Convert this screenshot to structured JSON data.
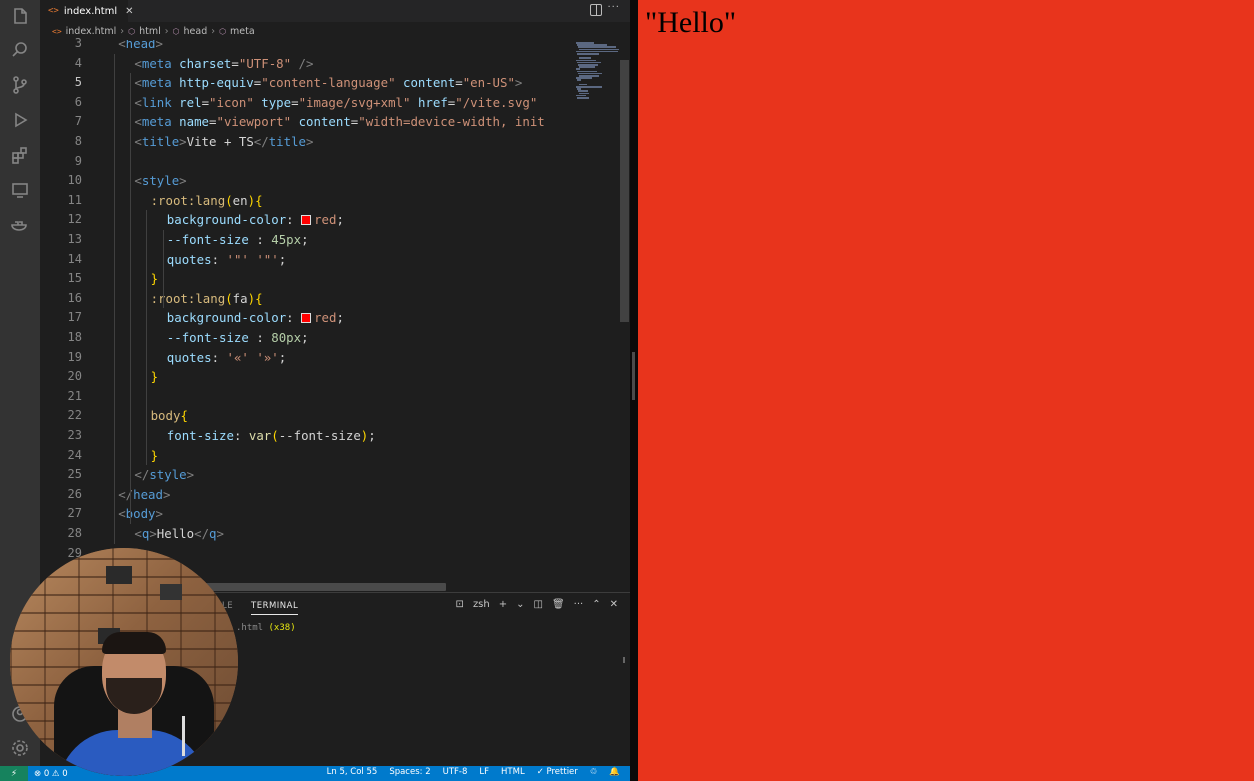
{
  "editor": {
    "tab": {
      "icon": "<>",
      "label": "index.html",
      "close": "✕"
    },
    "breadcrumb": [
      {
        "icon": "<>",
        "label": "index.html"
      },
      {
        "icon": "⬡",
        "label": "html"
      },
      {
        "icon": "⬡",
        "label": "head"
      },
      {
        "icon": "⬡",
        "label": "meta"
      }
    ],
    "active_line": 5,
    "code_lines": [
      {
        "n": 3,
        "indent": 1,
        "parts": [
          [
            "punct",
            "<"
          ],
          [
            "tag",
            "head"
          ],
          [
            "punct",
            ">"
          ]
        ]
      },
      {
        "n": 4,
        "indent": 2,
        "parts": [
          [
            "punct",
            "<"
          ],
          [
            "tag",
            "meta"
          ],
          [
            "plain",
            " "
          ],
          [
            "attr",
            "charset"
          ],
          [
            "plain",
            "="
          ],
          [
            "str",
            "\"UTF-8\""
          ],
          [
            "plain",
            " "
          ],
          [
            "punct",
            "/>"
          ]
        ]
      },
      {
        "n": 5,
        "indent": 2,
        "parts": [
          [
            "punct",
            "<"
          ],
          [
            "tag",
            "meta"
          ],
          [
            "plain",
            " "
          ],
          [
            "attr",
            "http-equiv"
          ],
          [
            "plain",
            "="
          ],
          [
            "str",
            "\"content-language\""
          ],
          [
            "plain",
            " "
          ],
          [
            "attr",
            "content"
          ],
          [
            "plain",
            "="
          ],
          [
            "str",
            "\"en-US\""
          ],
          [
            "punct",
            ">"
          ]
        ]
      },
      {
        "n": 6,
        "indent": 2,
        "parts": [
          [
            "punct",
            "<"
          ],
          [
            "tag",
            "link"
          ],
          [
            "plain",
            " "
          ],
          [
            "attr",
            "rel"
          ],
          [
            "plain",
            "="
          ],
          [
            "str",
            "\"icon\""
          ],
          [
            "plain",
            " "
          ],
          [
            "attr",
            "type"
          ],
          [
            "plain",
            "="
          ],
          [
            "str",
            "\"image/svg+xml\""
          ],
          [
            "plain",
            " "
          ],
          [
            "attr",
            "href"
          ],
          [
            "plain",
            "="
          ],
          [
            "str",
            "\"/vite.svg\""
          ]
        ]
      },
      {
        "n": 7,
        "indent": 2,
        "parts": [
          [
            "punct",
            "<"
          ],
          [
            "tag",
            "meta"
          ],
          [
            "plain",
            " "
          ],
          [
            "attr",
            "name"
          ],
          [
            "plain",
            "="
          ],
          [
            "str",
            "\"viewport\""
          ],
          [
            "plain",
            " "
          ],
          [
            "attr",
            "content"
          ],
          [
            "plain",
            "="
          ],
          [
            "str",
            "\"width=device-width, init"
          ]
        ]
      },
      {
        "n": 8,
        "indent": 2,
        "parts": [
          [
            "punct",
            "<"
          ],
          [
            "tag",
            "title"
          ],
          [
            "punct",
            ">"
          ],
          [
            "plain",
            "Vite + TS"
          ],
          [
            "punct",
            "</"
          ],
          [
            "tag",
            "title"
          ],
          [
            "punct",
            ">"
          ]
        ]
      },
      {
        "n": 9,
        "indent": 0,
        "parts": []
      },
      {
        "n": 10,
        "indent": 2,
        "parts": [
          [
            "punct",
            "<"
          ],
          [
            "tag",
            "style"
          ],
          [
            "punct",
            ">"
          ]
        ]
      },
      {
        "n": 11,
        "indent": 3,
        "parts": [
          [
            "sel",
            ":root:lang"
          ],
          [
            "brace",
            "("
          ],
          [
            "plain",
            "en"
          ],
          [
            "brace",
            ")"
          ],
          [
            "brace",
            "{"
          ]
        ]
      },
      {
        "n": 12,
        "indent": 4,
        "parts": [
          [
            "prop",
            "background-color"
          ],
          [
            "plain",
            ": "
          ],
          [
            "swatch",
            ""
          ],
          [
            "str",
            "red"
          ],
          [
            "plain",
            ";"
          ]
        ]
      },
      {
        "n": 13,
        "indent": 4,
        "parts": [
          [
            "prop",
            "--font-size"
          ],
          [
            "plain",
            " : "
          ],
          [
            "num",
            "45px"
          ],
          [
            "plain",
            ";"
          ]
        ]
      },
      {
        "n": 14,
        "indent": 4,
        "parts": [
          [
            "prop",
            "quotes"
          ],
          [
            "plain",
            ": "
          ],
          [
            "str",
            "'\"' '\"'"
          ],
          [
            "plain",
            ";"
          ]
        ]
      },
      {
        "n": 15,
        "indent": 3,
        "parts": [
          [
            "brace",
            "}"
          ]
        ]
      },
      {
        "n": 16,
        "indent": 3,
        "parts": [
          [
            "sel",
            ":root:lang"
          ],
          [
            "brace",
            "("
          ],
          [
            "plain",
            "fa"
          ],
          [
            "brace",
            ")"
          ],
          [
            "brace",
            "{"
          ]
        ]
      },
      {
        "n": 17,
        "indent": 4,
        "parts": [
          [
            "prop",
            "background-color"
          ],
          [
            "plain",
            ": "
          ],
          [
            "swatch",
            ""
          ],
          [
            "str",
            "red"
          ],
          [
            "plain",
            ";"
          ]
        ]
      },
      {
        "n": 18,
        "indent": 4,
        "parts": [
          [
            "prop",
            "--font-size"
          ],
          [
            "plain",
            " : "
          ],
          [
            "num",
            "80px"
          ],
          [
            "plain",
            ";"
          ]
        ]
      },
      {
        "n": 19,
        "indent": 4,
        "parts": [
          [
            "prop",
            "quotes"
          ],
          [
            "plain",
            ": "
          ],
          [
            "str",
            "'«' '»'"
          ],
          [
            "plain",
            ";"
          ]
        ]
      },
      {
        "n": 20,
        "indent": 3,
        "parts": [
          [
            "brace",
            "}"
          ]
        ]
      },
      {
        "n": 21,
        "indent": 0,
        "parts": []
      },
      {
        "n": 22,
        "indent": 3,
        "parts": [
          [
            "sel",
            "body"
          ],
          [
            "brace",
            "{"
          ]
        ]
      },
      {
        "n": 23,
        "indent": 4,
        "parts": [
          [
            "prop",
            "font-size"
          ],
          [
            "plain",
            ": "
          ],
          [
            "fn",
            "var"
          ],
          [
            "brace",
            "("
          ],
          [
            "plain",
            "--font-size"
          ],
          [
            "brace",
            ")"
          ],
          [
            "plain",
            ";"
          ]
        ]
      },
      {
        "n": 24,
        "indent": 3,
        "parts": [
          [
            "brace",
            "}"
          ]
        ]
      },
      {
        "n": 25,
        "indent": 2,
        "parts": [
          [
            "punct",
            "</"
          ],
          [
            "tag",
            "style"
          ],
          [
            "punct",
            ">"
          ]
        ]
      },
      {
        "n": 26,
        "indent": 1,
        "parts": [
          [
            "punct",
            "</"
          ],
          [
            "tag",
            "head"
          ],
          [
            "punct",
            ">"
          ]
        ]
      },
      {
        "n": 27,
        "indent": 1,
        "parts": [
          [
            "punct",
            "<"
          ],
          [
            "tag",
            "body"
          ],
          [
            "punct",
            ">"
          ]
        ]
      },
      {
        "n": 28,
        "indent": 2,
        "parts": [
          [
            "punct",
            "<"
          ],
          [
            "tag",
            "q"
          ],
          [
            "punct",
            ">"
          ],
          [
            "plain",
            "Hello"
          ],
          [
            "punct",
            "</"
          ],
          [
            "tag",
            "q"
          ],
          [
            "punct",
            ">"
          ]
        ]
      },
      {
        "n": 29,
        "indent": 0,
        "parts": []
      }
    ],
    "activity_icons": [
      "explorer-icon",
      "search-icon",
      "source-control-icon",
      "run-debug-icon",
      "extensions-icon",
      "remote-explorer-icon",
      "docker-icon",
      "account-icon",
      "settings-gear-icon"
    ]
  },
  "panel": {
    "partial_tab": "LE",
    "terminal_tab": "TERMINAL",
    "shell_label": "zsh",
    "terminal_text": ".html",
    "terminal_count": "(x38)"
  },
  "status_bar": {
    "remote": "⚡",
    "problems": "⊗ 0 ⚠ 0",
    "cursor": "Ln 5, Col 55",
    "spaces": "Spaces: 2",
    "encoding": "UTF-8",
    "eol": "LF",
    "language": "HTML",
    "formatter": "✓ Prettier"
  },
  "preview": {
    "text": "\"Hello\"",
    "background": "#e8341c"
  }
}
